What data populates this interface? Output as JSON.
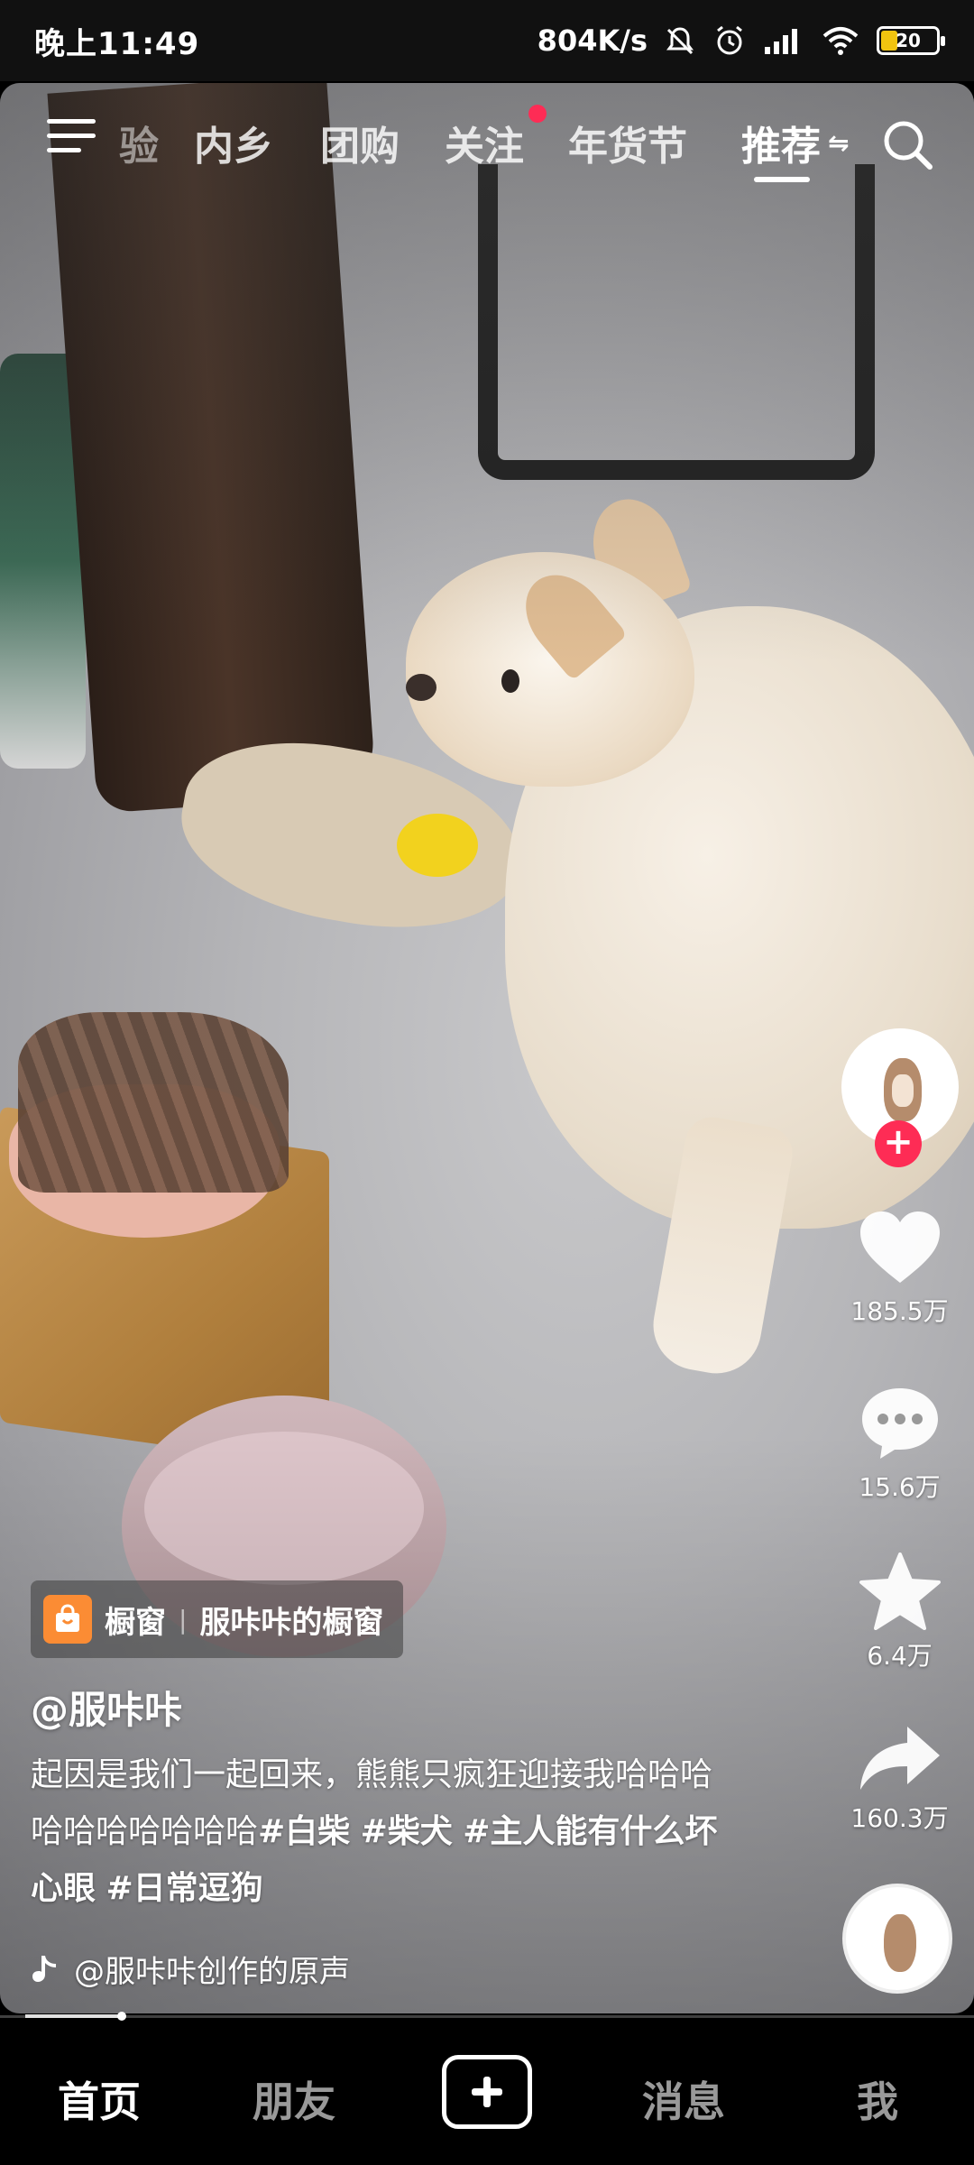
{
  "status_bar": {
    "time": "晚上11:49",
    "network_speed": "804K/s",
    "battery_level": "20"
  },
  "top_nav": {
    "tabs": [
      "验",
      "内乡",
      "团购",
      "关注",
      "年货节",
      "推荐"
    ],
    "active_tab": "推荐",
    "follow_has_dot": true
  },
  "actions": {
    "like_count": "185.5万",
    "comment_count": "15.6万",
    "favorite_count": "6.4万",
    "share_count": "160.3万"
  },
  "shop": {
    "label": "橱窗",
    "name": "服咔咔的橱窗"
  },
  "author": "@服咔咔",
  "caption": {
    "text": "起因是我们一起回来，熊熊只疯狂迎接我哈哈哈哈哈哈哈哈哈哈",
    "hashtags": [
      "#白柴",
      "#柴犬",
      "#主人能有什么坏心眼",
      "#日常逗狗"
    ]
  },
  "music": "@服咔咔创作的原声",
  "bottom_tabs": {
    "home": "首页",
    "friends": "朋友",
    "messages": "消息",
    "me": "我"
  },
  "colors": {
    "accent_red": "#fe2c55",
    "shop_orange": "#fb8c34"
  }
}
